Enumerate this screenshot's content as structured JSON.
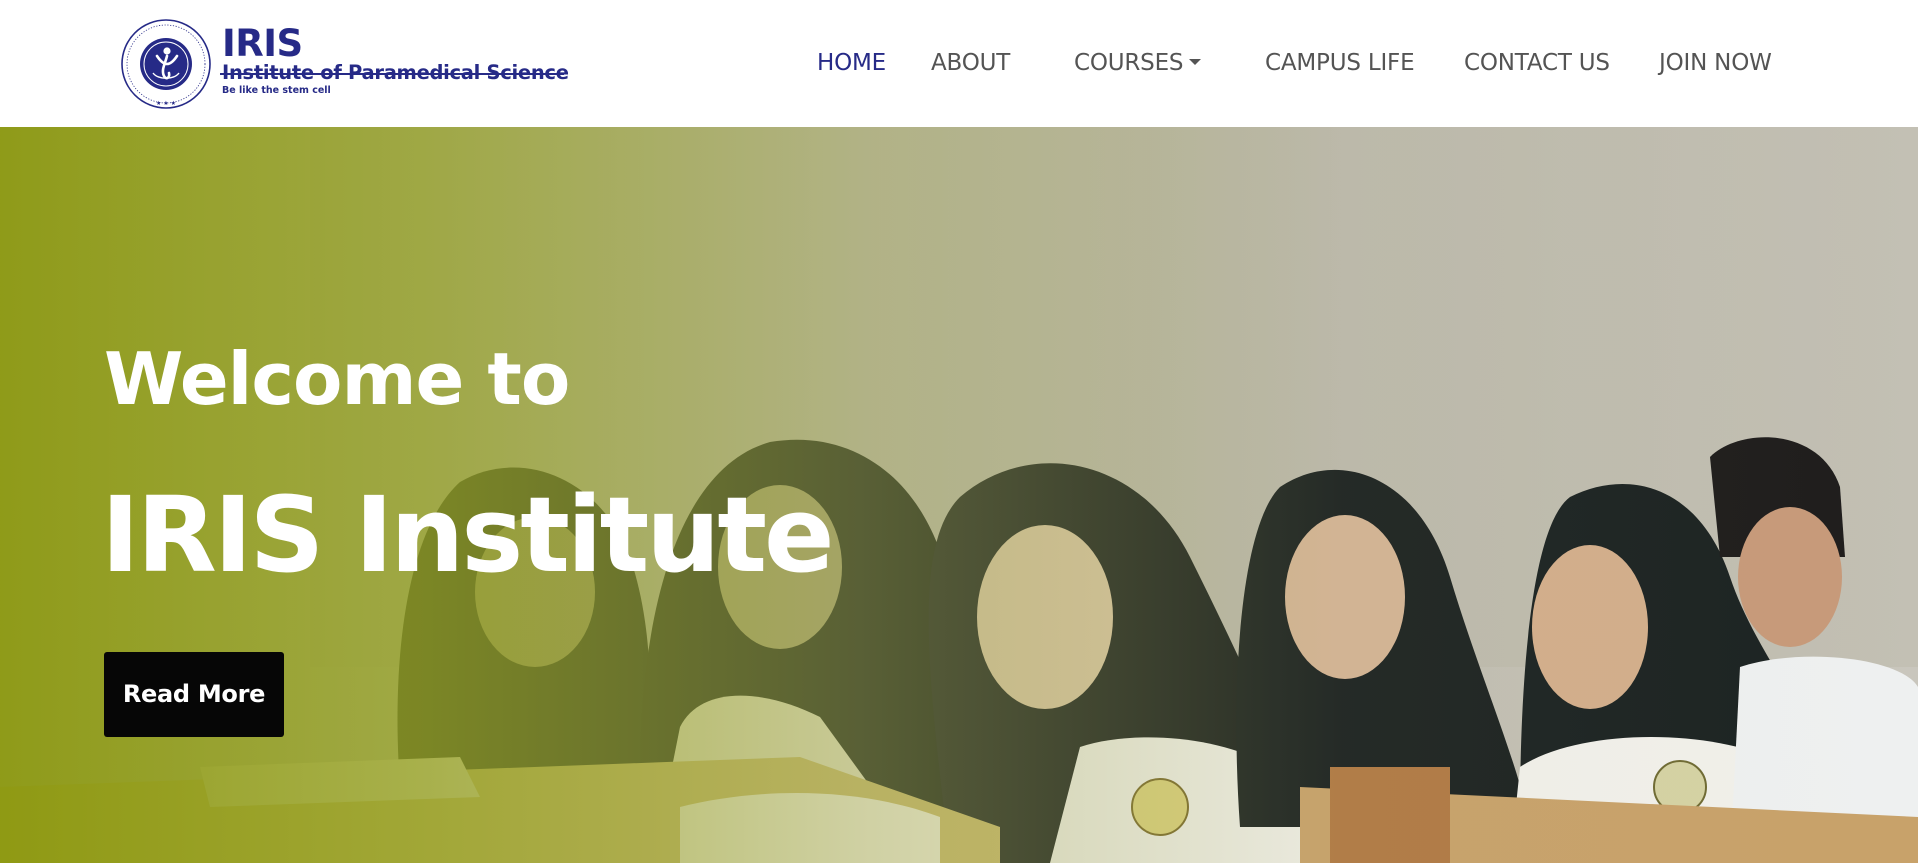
{
  "brand": {
    "name": "IRIS",
    "full_name": "Institute of Paramedical Science",
    "tagline": "Be like the stem cell",
    "seal_ring_text": "INSTITUTE OF PARAMEDICAL SCIENCE",
    "colors": {
      "primary": "#262a87",
      "nav_text": "#545454"
    }
  },
  "nav": {
    "items": [
      {
        "label": "HOME",
        "active": true
      },
      {
        "label": "ABOUT",
        "active": false
      },
      {
        "label": "COURSES",
        "active": false,
        "has_dropdown": true,
        "icon": "caret-down-icon"
      },
      {
        "label": "CAMPUS LIFE",
        "active": false
      },
      {
        "label": "CONTACT US",
        "active": false
      },
      {
        "label": "JOIN NOW",
        "active": false
      }
    ]
  },
  "hero": {
    "welcome": "Welcome to",
    "title": "IRIS Institute",
    "button_label": "Read More",
    "overlay_color": "#8a970c",
    "button_color": "#060606"
  }
}
